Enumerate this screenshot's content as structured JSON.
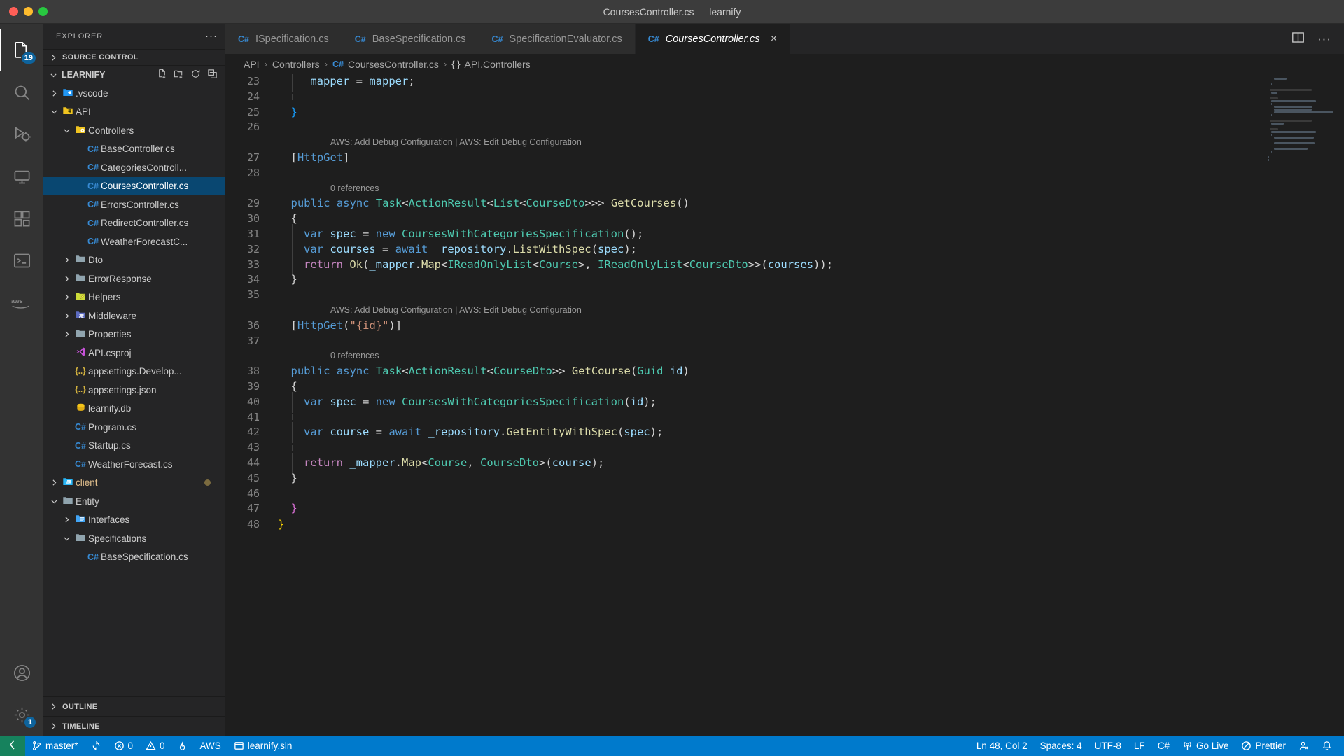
{
  "window": {
    "title": "CoursesController.cs — learnify",
    "traffic_lights": [
      "close",
      "minimize",
      "zoom"
    ]
  },
  "activity_bar": {
    "items": [
      {
        "name": "explorer",
        "icon": "files-icon",
        "badge": "19",
        "active": true
      },
      {
        "name": "search",
        "icon": "search-icon",
        "badge": null,
        "active": false
      },
      {
        "name": "run-debug",
        "icon": "run-debug-icon",
        "badge": null,
        "active": false
      },
      {
        "name": "remote-explorer",
        "icon": "remote-explorer-icon",
        "badge": null,
        "active": false
      },
      {
        "name": "extensions",
        "icon": "extensions-icon",
        "badge": null,
        "active": false
      },
      {
        "name": "terminal",
        "icon": "terminal-icon",
        "badge": null,
        "active": false
      },
      {
        "name": "aws",
        "icon": "aws-icon",
        "badge": null,
        "active": false
      }
    ],
    "bottom_items": [
      {
        "name": "accounts",
        "icon": "account-icon",
        "badge": null
      },
      {
        "name": "settings",
        "icon": "gear-icon",
        "badge": "1"
      }
    ]
  },
  "sidebar": {
    "title": "EXPLORER",
    "more_actions": "···",
    "source_control_section": "SOURCE CONTROL",
    "workspace_name": "LEARNIFY",
    "workspace_actions": [
      "new-file-icon",
      "new-folder-icon",
      "refresh-icon",
      "collapse-all-icon"
    ],
    "outline_section": "OUTLINE",
    "timeline_section": "TIMELINE",
    "tree": [
      {
        "label": ".vscode",
        "type": "folder",
        "icon": "vscode-folder-icon",
        "depth": 1,
        "expanded": false,
        "selected": false
      },
      {
        "label": "API",
        "type": "folder",
        "icon": "api-folder-icon",
        "depth": 1,
        "expanded": true,
        "selected": false
      },
      {
        "label": "Controllers",
        "type": "folder",
        "icon": "controller-folder-icon",
        "depth": 2,
        "expanded": true,
        "selected": false
      },
      {
        "label": "BaseController.cs",
        "type": "file",
        "icon": "csharp-icon",
        "depth": 3,
        "selected": false
      },
      {
        "label": "CategoriesControll...",
        "type": "file",
        "icon": "csharp-icon",
        "depth": 3,
        "selected": false
      },
      {
        "label": "CoursesController.cs",
        "type": "file",
        "icon": "csharp-icon",
        "depth": 3,
        "selected": true
      },
      {
        "label": "ErrorsController.cs",
        "type": "file",
        "icon": "csharp-icon",
        "depth": 3,
        "selected": false
      },
      {
        "label": "RedirectController.cs",
        "type": "file",
        "icon": "csharp-icon",
        "depth": 3,
        "selected": false
      },
      {
        "label": "WeatherForecastC...",
        "type": "file",
        "icon": "csharp-icon",
        "depth": 3,
        "selected": false
      },
      {
        "label": "Dto",
        "type": "folder",
        "icon": "plain-folder-icon",
        "depth": 2,
        "expanded": false,
        "selected": false
      },
      {
        "label": "ErrorResponse",
        "type": "folder",
        "icon": "plain-folder-icon",
        "depth": 2,
        "expanded": false,
        "selected": false
      },
      {
        "label": "Helpers",
        "type": "folder",
        "icon": "helper-folder-icon",
        "depth": 2,
        "expanded": false,
        "selected": false
      },
      {
        "label": "Middleware",
        "type": "folder",
        "icon": "middleware-folder-icon",
        "depth": 2,
        "expanded": false,
        "selected": false
      },
      {
        "label": "Properties",
        "type": "folder",
        "icon": "plain-folder-icon",
        "depth": 2,
        "expanded": false,
        "selected": false
      },
      {
        "label": "API.csproj",
        "type": "file",
        "icon": "visualstudio-icon",
        "depth": 2,
        "selected": false
      },
      {
        "label": "appsettings.Develop...",
        "type": "file",
        "icon": "json-icon",
        "depth": 2,
        "selected": false
      },
      {
        "label": "appsettings.json",
        "type": "file",
        "icon": "json-icon",
        "depth": 2,
        "selected": false
      },
      {
        "label": "learnify.db",
        "type": "file",
        "icon": "database-icon",
        "depth": 2,
        "selected": false
      },
      {
        "label": "Program.cs",
        "type": "file",
        "icon": "csharp-icon",
        "depth": 2,
        "selected": false
      },
      {
        "label": "Startup.cs",
        "type": "file",
        "icon": "csharp-icon",
        "depth": 2,
        "selected": false
      },
      {
        "label": "WeatherForecast.cs",
        "type": "file",
        "icon": "csharp-icon",
        "depth": 2,
        "selected": false
      },
      {
        "label": "client",
        "type": "folder",
        "icon": "client-folder-icon",
        "depth": 1,
        "expanded": false,
        "selected": false,
        "modified": true
      },
      {
        "label": "Entity",
        "type": "folder",
        "icon": "plain-folder-icon",
        "depth": 1,
        "expanded": true,
        "selected": false
      },
      {
        "label": "Interfaces",
        "type": "folder",
        "icon": "interface-folder-icon",
        "depth": 2,
        "expanded": false,
        "selected": false
      },
      {
        "label": "Specifications",
        "type": "folder",
        "icon": "plain-folder-icon",
        "depth": 2,
        "expanded": true,
        "selected": false
      },
      {
        "label": "BaseSpecification.cs",
        "type": "file",
        "icon": "csharp-icon",
        "depth": 3,
        "selected": false
      }
    ]
  },
  "editor": {
    "tabs": [
      {
        "label": "ISpecification.cs",
        "icon": "csharp-icon",
        "active": false,
        "closable": false
      },
      {
        "label": "BaseSpecification.cs",
        "icon": "csharp-icon",
        "active": false,
        "closable": false
      },
      {
        "label": "SpecificationEvaluator.cs",
        "icon": "csharp-icon",
        "active": false,
        "closable": false
      },
      {
        "label": "CoursesController.cs",
        "icon": "csharp-icon",
        "active": true,
        "closable": true
      }
    ],
    "tab_close_label": "×",
    "tab_actions": [
      "split-editor-icon",
      "more-actions-icon"
    ],
    "breadcrumbs": [
      {
        "label": "API",
        "icon": null
      },
      {
        "label": "Controllers",
        "icon": null
      },
      {
        "label": "CoursesController.cs",
        "icon": "csharp-icon"
      },
      {
        "label": "API.Controllers",
        "icon": "namespace-icon"
      }
    ],
    "breadcrumb_separator": "›",
    "namespace_glyph": "{ }",
    "lines": [
      {
        "num": "23",
        "indent": 2,
        "tokens": [
          {
            "t": "_mapper ",
            "c": "va"
          },
          {
            "t": "= ",
            "c": "br"
          },
          {
            "t": "mapper",
            "c": "va"
          },
          {
            "t": ";",
            "c": "br"
          }
        ]
      },
      {
        "num": "24",
        "indent": 2,
        "tokens": []
      },
      {
        "num": "25",
        "indent": 1,
        "tokens": [
          {
            "t": "}",
            "c": "bracket-b"
          }
        ]
      },
      {
        "num": "26",
        "indent": 0,
        "tokens": []
      },
      {
        "codelens": "AWS: Add Debug Configuration | AWS: Edit Debug Configuration",
        "indent": 1
      },
      {
        "num": "27",
        "indent": 1,
        "tokens": [
          {
            "t": "[",
            "c": "br"
          },
          {
            "t": "HttpGet",
            "c": "lens-blue"
          },
          {
            "t": "]",
            "c": "br"
          }
        ]
      },
      {
        "num": "28",
        "indent": 0,
        "tokens": []
      },
      {
        "codelens": "0 references",
        "indent": 1
      },
      {
        "num": "29",
        "indent": 1,
        "tokens": [
          {
            "t": "public ",
            "c": "kw"
          },
          {
            "t": "async ",
            "c": "kw"
          },
          {
            "t": "Task",
            "c": "ty"
          },
          {
            "t": "<",
            "c": "br"
          },
          {
            "t": "ActionResult",
            "c": "ty"
          },
          {
            "t": "<",
            "c": "br"
          },
          {
            "t": "List",
            "c": "ty"
          },
          {
            "t": "<",
            "c": "br"
          },
          {
            "t": "CourseDto",
            "c": "ty"
          },
          {
            "t": ">>> ",
            "c": "br"
          },
          {
            "t": "GetCourses",
            "c": "me"
          },
          {
            "t": "()",
            "c": "br"
          }
        ]
      },
      {
        "num": "30",
        "indent": 1,
        "tokens": [
          {
            "t": "{",
            "c": "br"
          }
        ]
      },
      {
        "num": "31",
        "indent": 2,
        "tokens": [
          {
            "t": "var ",
            "c": "kw"
          },
          {
            "t": "spec ",
            "c": "va"
          },
          {
            "t": "= ",
            "c": "br"
          },
          {
            "t": "new ",
            "c": "kw"
          },
          {
            "t": "CoursesWithCategoriesSpecification",
            "c": "ty"
          },
          {
            "t": "();",
            "c": "br"
          }
        ]
      },
      {
        "num": "32",
        "indent": 2,
        "tokens": [
          {
            "t": "var ",
            "c": "kw"
          },
          {
            "t": "courses ",
            "c": "va"
          },
          {
            "t": "= ",
            "c": "br"
          },
          {
            "t": "await ",
            "c": "kw"
          },
          {
            "t": "_repository",
            "c": "va"
          },
          {
            "t": ".",
            "c": "br"
          },
          {
            "t": "ListWithSpec",
            "c": "me"
          },
          {
            "t": "(",
            "c": "br"
          },
          {
            "t": "spec",
            "c": "va"
          },
          {
            "t": ");",
            "c": "br"
          }
        ]
      },
      {
        "num": "33",
        "indent": 2,
        "tokens": [
          {
            "t": "return ",
            "c": "pu"
          },
          {
            "t": "Ok",
            "c": "me"
          },
          {
            "t": "(",
            "c": "br"
          },
          {
            "t": "_mapper",
            "c": "va"
          },
          {
            "t": ".",
            "c": "br"
          },
          {
            "t": "Map",
            "c": "me"
          },
          {
            "t": "<",
            "c": "br"
          },
          {
            "t": "IReadOnlyList",
            "c": "ty"
          },
          {
            "t": "<",
            "c": "br"
          },
          {
            "t": "Course",
            "c": "ty"
          },
          {
            "t": ">, ",
            "c": "br"
          },
          {
            "t": "IReadOnlyList",
            "c": "ty"
          },
          {
            "t": "<",
            "c": "br"
          },
          {
            "t": "CourseDto",
            "c": "ty"
          },
          {
            "t": ">>(",
            "c": "br"
          },
          {
            "t": "courses",
            "c": "va"
          },
          {
            "t": "));",
            "c": "br"
          }
        ]
      },
      {
        "num": "34",
        "indent": 1,
        "tokens": [
          {
            "t": "}",
            "c": "br"
          }
        ]
      },
      {
        "num": "35",
        "indent": 0,
        "tokens": []
      },
      {
        "codelens": "AWS: Add Debug Configuration | AWS: Edit Debug Configuration",
        "indent": 1
      },
      {
        "num": "36",
        "indent": 1,
        "tokens": [
          {
            "t": "[",
            "c": "br"
          },
          {
            "t": "HttpGet",
            "c": "lens-blue"
          },
          {
            "t": "(",
            "c": "br"
          },
          {
            "t": "\"{id}\"",
            "c": "st"
          },
          {
            "t": ")]",
            "c": "br"
          }
        ]
      },
      {
        "num": "37",
        "indent": 0,
        "tokens": []
      },
      {
        "codelens": "0 references",
        "indent": 1
      },
      {
        "num": "38",
        "indent": 1,
        "tokens": [
          {
            "t": "public ",
            "c": "kw"
          },
          {
            "t": "async ",
            "c": "kw"
          },
          {
            "t": "Task",
            "c": "ty"
          },
          {
            "t": "<",
            "c": "br"
          },
          {
            "t": "ActionResult",
            "c": "ty"
          },
          {
            "t": "<",
            "c": "br"
          },
          {
            "t": "CourseDto",
            "c": "ty"
          },
          {
            "t": ">> ",
            "c": "br"
          },
          {
            "t": "GetCourse",
            "c": "me"
          },
          {
            "t": "(",
            "c": "br"
          },
          {
            "t": "Guid ",
            "c": "ty"
          },
          {
            "t": "id",
            "c": "va"
          },
          {
            "t": ")",
            "c": "br"
          }
        ]
      },
      {
        "num": "39",
        "indent": 1,
        "tokens": [
          {
            "t": "{",
            "c": "br"
          }
        ]
      },
      {
        "num": "40",
        "indent": 2,
        "tokens": [
          {
            "t": "var ",
            "c": "kw"
          },
          {
            "t": "spec ",
            "c": "va"
          },
          {
            "t": "= ",
            "c": "br"
          },
          {
            "t": "new ",
            "c": "kw"
          },
          {
            "t": "CoursesWithCategoriesSpecification",
            "c": "ty"
          },
          {
            "t": "(",
            "c": "br"
          },
          {
            "t": "id",
            "c": "va"
          },
          {
            "t": ");",
            "c": "br"
          }
        ]
      },
      {
        "num": "41",
        "indent": 2,
        "tokens": []
      },
      {
        "num": "42",
        "indent": 2,
        "tokens": [
          {
            "t": "var ",
            "c": "kw"
          },
          {
            "t": "course ",
            "c": "va"
          },
          {
            "t": "= ",
            "c": "br"
          },
          {
            "t": "await ",
            "c": "kw"
          },
          {
            "t": "_repository",
            "c": "va"
          },
          {
            "t": ".",
            "c": "br"
          },
          {
            "t": "GetEntityWithSpec",
            "c": "me"
          },
          {
            "t": "(",
            "c": "br"
          },
          {
            "t": "spec",
            "c": "va"
          },
          {
            "t": ");",
            "c": "br"
          }
        ]
      },
      {
        "num": "43",
        "indent": 2,
        "tokens": []
      },
      {
        "num": "44",
        "indent": 2,
        "tokens": [
          {
            "t": "return ",
            "c": "pu"
          },
          {
            "t": "_mapper",
            "c": "va"
          },
          {
            "t": ".",
            "c": "br"
          },
          {
            "t": "Map",
            "c": "me"
          },
          {
            "t": "<",
            "c": "br"
          },
          {
            "t": "Course",
            "c": "ty"
          },
          {
            "t": ", ",
            "c": "br"
          },
          {
            "t": "CourseDto",
            "c": "ty"
          },
          {
            "t": ">(",
            "c": "br"
          },
          {
            "t": "course",
            "c": "va"
          },
          {
            "t": ");",
            "c": "br"
          }
        ]
      },
      {
        "num": "45",
        "indent": 1,
        "tokens": [
          {
            "t": "}",
            "c": "br"
          }
        ]
      },
      {
        "num": "46",
        "indent": 0,
        "tokens": []
      },
      {
        "num": "47",
        "indent": 0,
        "tokens": [
          {
            "t": "}",
            "c": "bracket-p"
          }
        ],
        "extra_indent": 1
      },
      {
        "num": "48",
        "indent": 0,
        "tokens": [
          {
            "t": "}",
            "c": "bracket-y"
          }
        ]
      }
    ]
  },
  "status_bar": {
    "left": [
      {
        "name": "remote-indicator",
        "label": "",
        "icon": "remote-icon"
      },
      {
        "name": "branch",
        "label": "master*",
        "icon": "source-control-icon"
      },
      {
        "name": "sync",
        "label": "",
        "icon": "sync-icon"
      },
      {
        "name": "errors",
        "label": "0",
        "icon": "error-icon"
      },
      {
        "name": "warnings",
        "label": "0",
        "icon": "warning-icon"
      },
      {
        "name": "flame",
        "label": "",
        "icon": "flame-icon"
      },
      {
        "name": "aws",
        "label": "AWS",
        "icon": null
      },
      {
        "name": "solution",
        "label": "learnify.sln",
        "icon": "window-icon"
      }
    ],
    "right": [
      {
        "name": "cursor-position",
        "label": "Ln 48, Col 2",
        "icon": null
      },
      {
        "name": "indentation",
        "label": "Spaces: 4",
        "icon": null
      },
      {
        "name": "encoding",
        "label": "UTF-8",
        "icon": null
      },
      {
        "name": "eol",
        "label": "LF",
        "icon": null
      },
      {
        "name": "language-mode",
        "label": "C#",
        "icon": null
      },
      {
        "name": "go-live",
        "label": "Go Live",
        "icon": "broadcast-icon"
      },
      {
        "name": "prettier",
        "label": "Prettier",
        "icon": "prettier-icon"
      },
      {
        "name": "feedback",
        "label": "",
        "icon": "feedback-icon"
      },
      {
        "name": "notifications",
        "label": "",
        "icon": "bell-icon"
      }
    ]
  },
  "colors": {
    "accent": "#007acc",
    "remote_green": "#16825d",
    "selection_blue": "#094771",
    "editor_bg": "#1e1e1e",
    "sidebar_bg": "#252526",
    "activitybar_bg": "#333333",
    "titlebar_bg": "#3c3c3c",
    "keyword": "#569cd6",
    "type": "#4ec9b0",
    "method": "#dcdcaa",
    "string": "#ce9178",
    "control": "#c586c0",
    "variable": "#9cdcfe",
    "badge_blue": "#0e639c",
    "modified_gold": "#e2c08d"
  }
}
